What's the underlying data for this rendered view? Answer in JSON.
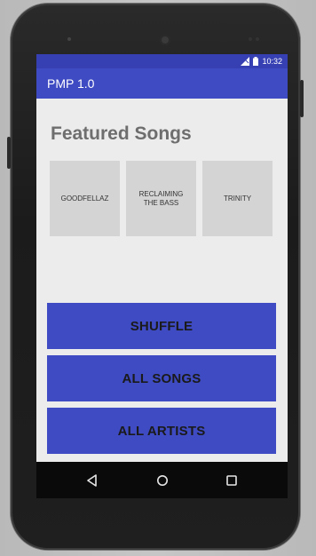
{
  "status_bar": {
    "time": "10:32",
    "icons": [
      "signal-icon",
      "battery-icon"
    ]
  },
  "app_bar": {
    "title": "PMP 1.0"
  },
  "featured": {
    "title": "Featured Songs",
    "tiles": [
      {
        "label": "GOODFELLAZ"
      },
      {
        "label": "RECLAIMING THE BASS"
      },
      {
        "label": "TRINITY"
      }
    ]
  },
  "actions": {
    "shuffle_label": "SHUFFLE",
    "all_songs_label": "ALL SONGS",
    "all_artists_label": "ALL ARTISTS"
  },
  "nav_bar": {
    "icons": [
      "back-icon",
      "home-icon",
      "recents-icon"
    ]
  },
  "colors": {
    "primary": "#3f4bc2",
    "primary_dark": "#3640b2",
    "tile_bg": "#d4d4d4",
    "screen_bg": "#ececec",
    "title_text": "#6e6e6e"
  }
}
